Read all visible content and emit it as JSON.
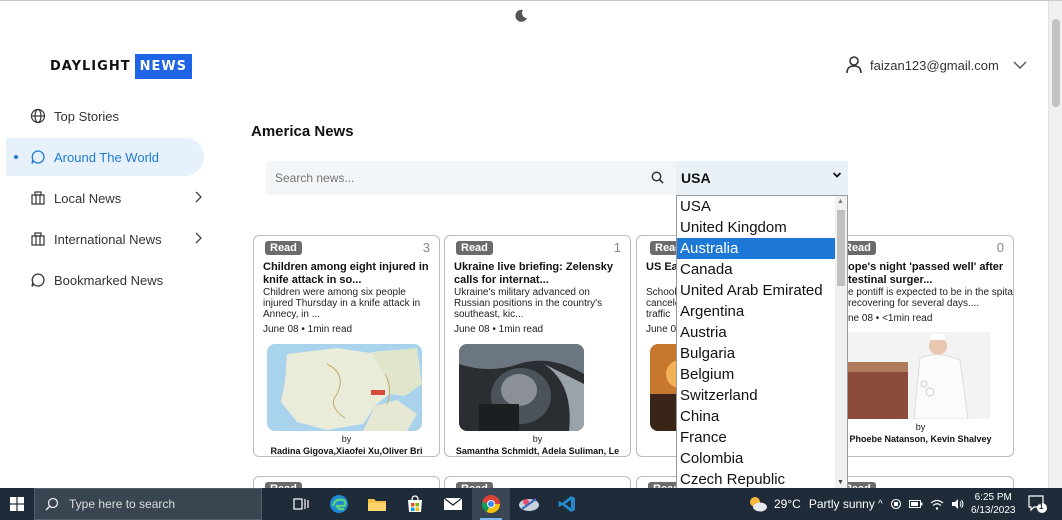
{
  "header": {
    "logo_part1": "DAYLIGHT",
    "logo_part2": "NEWS",
    "user_email": "faizan123@gmail.com"
  },
  "sidebar": {
    "items": [
      {
        "label": "Top Stories",
        "icon": "globe-icon",
        "active": false,
        "has_arrow": false
      },
      {
        "label": "Around The World",
        "icon": "chat-bubble-icon",
        "active": true,
        "has_arrow": false
      },
      {
        "label": "Local News",
        "icon": "building-icon",
        "active": false,
        "has_arrow": true
      },
      {
        "label": "International News",
        "icon": "building-icon",
        "active": false,
        "has_arrow": true
      },
      {
        "label": "Bookmarked News",
        "icon": "chat-bubble-icon",
        "active": false,
        "has_arrow": false
      }
    ]
  },
  "main": {
    "section_title": "America News",
    "search_placeholder": "Search news...",
    "country_selected": "USA",
    "country_options": [
      "USA",
      "United Kingdom",
      "Australia",
      "Canada",
      "United Arab Emirated",
      "Argentina",
      "Austria",
      "Bulgaria",
      "Belgium",
      "Switzerland",
      "China",
      "France",
      "Colombia",
      "Czech Republic"
    ],
    "highlighted_option": "Australia",
    "cards": [
      {
        "badge": "Read",
        "count": "3",
        "title": "Children among eight injured in knife attack in so...",
        "desc": "Children were among six people injured Thursday in a knife attack in Annecy, in ...",
        "meta": "June 08 • 1min read",
        "by": "by",
        "authors": "Radina Gigova,Xiaofei Xu,Oliver Bri",
        "image": "map-image"
      },
      {
        "badge": "Read",
        "count": "1",
        "title": "Ukraine live briefing: Zelensky calls for internat...",
        "desc": "Ukraine's military advanced on Russian positions in the country's southeast, kic...",
        "meta": "June 08 • 1min read",
        "by": "by",
        "authors": "Samantha Schmidt, Adela Suliman, Le",
        "image": "soldier-image"
      },
      {
        "badge": "Read",
        "count": "",
        "title": "US Ea... smoke",
        "desc": "School... cancele... traffic",
        "meta": "June 0",
        "by": "",
        "authors": "",
        "image": "smoke-image"
      },
      {
        "badge": "Read",
        "count": "0",
        "title": "ope's night 'passed well' after testinal surger...",
        "desc": "e pontiff is expected to be in the spital recovering for several days....",
        "meta": "ne 08 • <1min read",
        "by": "by",
        "authors": "Phoebe Natanson, Kevin Shalvey",
        "image": "pope-image"
      }
    ],
    "next_row_badges": [
      "Read",
      "Read",
      "Read",
      "Read"
    ]
  },
  "taskbar": {
    "search_placeholder": "Type here to search",
    "temperature": "29°C",
    "condition": "Partly sunny",
    "time": "6:25 PM",
    "date": "6/13/2023",
    "notification_count": "1"
  }
}
